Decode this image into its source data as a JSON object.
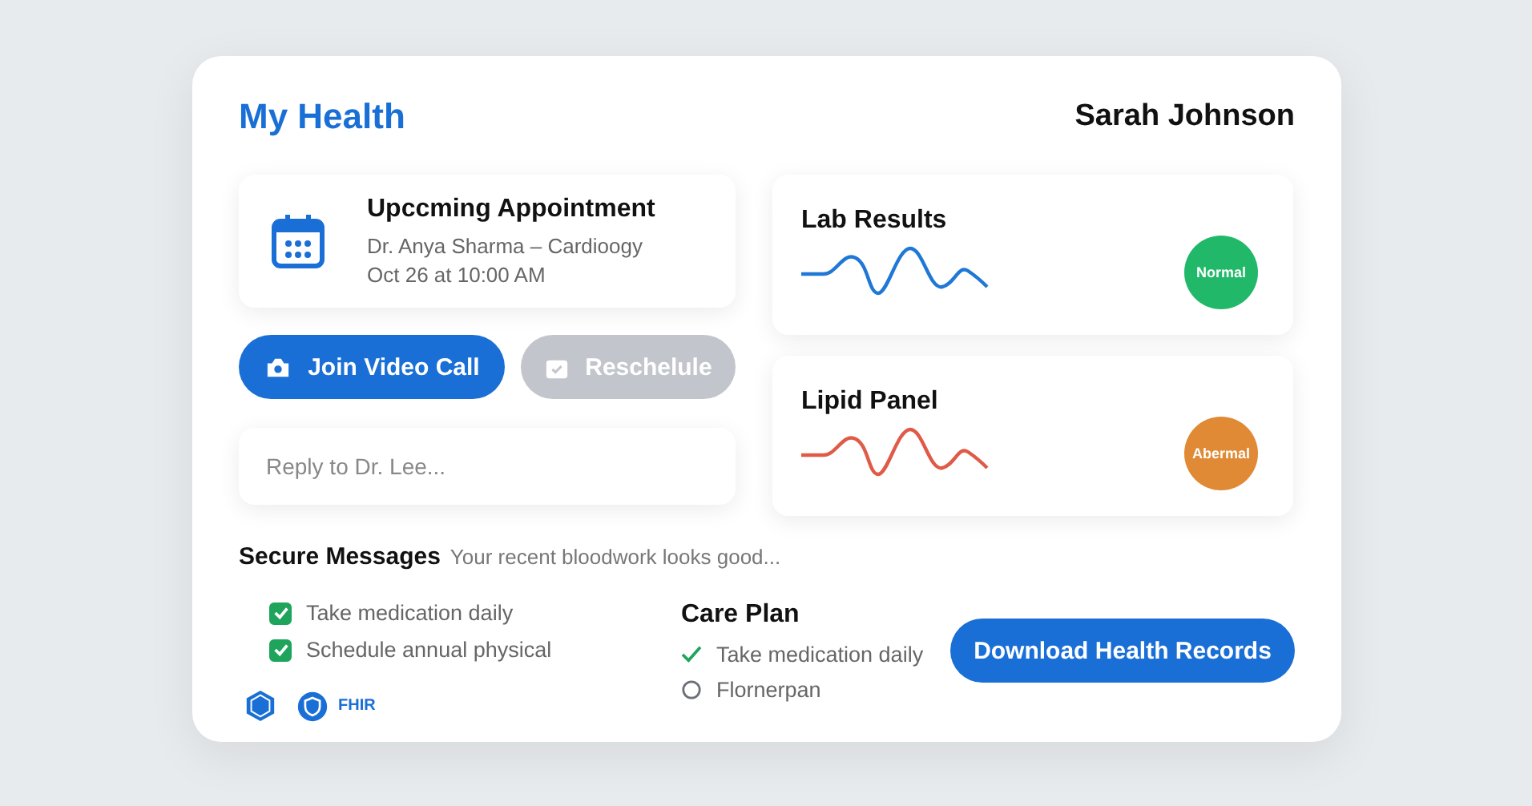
{
  "header": {
    "title": "My Health",
    "user": "Sarah Johnson"
  },
  "appointment": {
    "title": "Upccming Appointment",
    "doctor": "Dr. Anya Sharma – Cardioogy",
    "time": "Oct 26 at 10:00 AM"
  },
  "actions": [
    {
      "label": "Join Video Call",
      "disabled": false
    },
    {
      "label": "Reschelule",
      "disabled": true
    }
  ],
  "reply": {
    "placeholder": "Reply to Dr. Lee..."
  },
  "results": [
    {
      "title": "Lab Results",
      "status": "Normal",
      "color": "#22b86a"
    },
    {
      "title": "Lipid Panel",
      "status": "Abermal",
      "color": "#e08a35"
    }
  ],
  "messages": {
    "title": "Secure Messages",
    "preview": "Your recent bloodwork looks good..."
  },
  "checklist": [
    {
      "label": "Take medication daily",
      "checked": true
    },
    {
      "label": "Schedule annual physical",
      "checked": true
    }
  ],
  "badges": {
    "label": "FHIR"
  },
  "care_plan": {
    "title": "Care Plan",
    "items": [
      {
        "label": "Take medication daily",
        "checked": true
      },
      {
        "label": "Flornerpan",
        "checked": false
      }
    ]
  },
  "download": {
    "label": "Download Health Records"
  }
}
